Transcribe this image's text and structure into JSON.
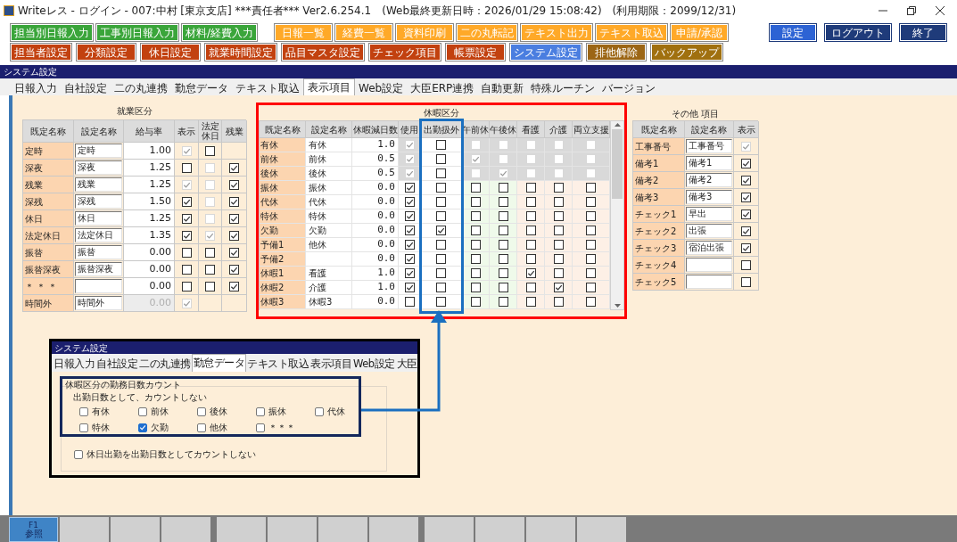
{
  "title_bar": {
    "app": "Writeレス - ログイン - 007:中村 [東京支店] ***責任者***  Ver2.6.254.1",
    "updated": "(Web最終更新日時：2026/01/29 15:08:42)",
    "expiry": "(利用期限：2099/12/31)"
  },
  "toolbar_rows": [
    [
      {
        "label": "担当別日報入力",
        "color": "#3aa53a"
      },
      {
        "label": "工事別日報入力",
        "color": "#3aa53a"
      },
      {
        "label": "材料/経費入力",
        "color": "#3aa53a"
      },
      {
        "label": "日報一覧",
        "color": "#ffa928"
      },
      {
        "label": "経費一覧",
        "color": "#ffa928"
      },
      {
        "label": "資料印刷",
        "color": "#ffa928"
      },
      {
        "label": "二の丸転記",
        "color": "#ffa928"
      },
      {
        "label": "テキスト出力",
        "color": "#ffa928"
      },
      {
        "label": "テキスト取込",
        "color": "#ffa928"
      },
      {
        "label": "申請/承認",
        "color": "#ffa928"
      }
    ],
    [
      {
        "label": "担当者設定",
        "color": "#c2410f"
      },
      {
        "label": "分類設定",
        "color": "#c2410f"
      },
      {
        "label": "休日設定",
        "color": "#c2410f"
      },
      {
        "label": "就業時間設定",
        "color": "#c2410f"
      },
      {
        "label": "品目マスタ設定",
        "color": "#c2410f"
      },
      {
        "label": "チェック項目",
        "color": "#c2410f"
      },
      {
        "label": "帳票設定",
        "color": "#c2410f"
      },
      {
        "label": "システム設定",
        "color": "#4a7ee0"
      },
      {
        "label": "排他解除",
        "color": "#9c6615"
      },
      {
        "label": "バックアップ",
        "color": "#a0700f"
      }
    ]
  ],
  "right_buttons": [
    {
      "label": "設定",
      "color": "#2d63d4"
    },
    {
      "label": "ログアウト",
      "color": "#1f3b7a"
    },
    {
      "label": "終了",
      "color": "#1f3b7a"
    }
  ],
  "panel_title": "システム設定",
  "tabs": [
    {
      "label": "日報入力",
      "selected": false
    },
    {
      "label": "自社設定",
      "selected": false
    },
    {
      "label": "二の丸連携",
      "selected": false
    },
    {
      "label": "勤怠データ",
      "selected": false
    },
    {
      "label": "テキスト取込",
      "selected": false
    },
    {
      "label": "表示項目",
      "selected": true
    },
    {
      "label": "Web設定",
      "selected": false
    },
    {
      "label": "大臣ERP連携",
      "selected": false
    },
    {
      "label": "自動更新",
      "selected": false
    },
    {
      "label": "特殊ルーチン",
      "selected": false
    },
    {
      "label": "バージョン",
      "selected": false
    }
  ],
  "work_table": {
    "title": "就業区分",
    "columns": [
      "既定名称",
      "設定名称",
      "給与率",
      "表示",
      "法定休日",
      "残業"
    ],
    "rows": [
      {
        "default_name": "定時",
        "setting_name": "定時",
        "rate": "1.00",
        "rate_disabled": false,
        "checks": [
          {
            "kind": "box",
            "checked": true,
            "disabled": true
          },
          {
            "kind": "box",
            "checked": false,
            "disabled": false
          },
          {
            "kind": "none"
          }
        ]
      },
      {
        "default_name": "深夜",
        "setting_name": "深夜",
        "rate": "1.25",
        "rate_disabled": false,
        "checks": [
          {
            "kind": "box",
            "checked": false,
            "disabled": false
          },
          {
            "kind": "box",
            "checked": false,
            "disabled": true
          },
          {
            "kind": "box",
            "checked": true,
            "disabled": false
          }
        ]
      },
      {
        "default_name": "残業",
        "setting_name": "残業",
        "rate": "1.25",
        "rate_disabled": false,
        "checks": [
          {
            "kind": "box",
            "checked": true,
            "disabled": true
          },
          {
            "kind": "box",
            "checked": false,
            "disabled": true
          },
          {
            "kind": "box",
            "checked": true,
            "disabled": false
          }
        ]
      },
      {
        "default_name": "深残",
        "setting_name": "深残",
        "rate": "1.50",
        "rate_disabled": false,
        "checks": [
          {
            "kind": "box",
            "checked": true,
            "disabled": false
          },
          {
            "kind": "box",
            "checked": false,
            "disabled": true
          },
          {
            "kind": "box",
            "checked": true,
            "disabled": false
          }
        ]
      },
      {
        "default_name": "休日",
        "setting_name": "休日",
        "rate": "1.25",
        "rate_disabled": false,
        "checks": [
          {
            "kind": "box",
            "checked": true,
            "disabled": false
          },
          {
            "kind": "box",
            "checked": false,
            "disabled": true
          },
          {
            "kind": "box",
            "checked": true,
            "disabled": false
          }
        ]
      },
      {
        "default_name": "法定休日",
        "setting_name": "法定休日",
        "rate": "1.35",
        "rate_disabled": false,
        "checks": [
          {
            "kind": "box",
            "checked": true,
            "disabled": false
          },
          {
            "kind": "box",
            "checked": true,
            "disabled": true
          },
          {
            "kind": "box",
            "checked": true,
            "disabled": false
          }
        ]
      },
      {
        "default_name": "振替",
        "setting_name": "振替",
        "rate": "0.00",
        "rate_disabled": false,
        "checks": [
          {
            "kind": "box",
            "checked": false,
            "disabled": false
          },
          {
            "kind": "box",
            "checked": false,
            "disabled": false
          },
          {
            "kind": "box",
            "checked": true,
            "disabled": false
          }
        ]
      },
      {
        "default_name": "振替深夜",
        "setting_name": "振替深夜",
        "rate": "0.00",
        "rate_disabled": false,
        "checks": [
          {
            "kind": "box",
            "checked": false,
            "disabled": false
          },
          {
            "kind": "box",
            "checked": false,
            "disabled": false
          },
          {
            "kind": "box",
            "checked": true,
            "disabled": false
          }
        ]
      },
      {
        "default_name": "＊ ＊ ＊",
        "rate": "0.00",
        "rate_disabled": false,
        "checks": [
          {
            "kind": "box",
            "checked": false,
            "disabled": false
          },
          {
            "kind": "box",
            "checked": false,
            "disabled": false
          },
          {
            "kind": "box",
            "checked": true,
            "disabled": false
          }
        ]
      },
      {
        "default_name": "時間外",
        "setting_name": "時間外",
        "rate": "0.00",
        "rate_disabled": true,
        "checks": [
          {
            "kind": "box",
            "checked": true,
            "disabled": true
          },
          {
            "kind": "none"
          },
          {
            "kind": "none"
          }
        ]
      }
    ]
  },
  "leave_table": {
    "title": "休暇区分",
    "columns": [
      {
        "label": "既定名称"
      },
      {
        "label": "設定名称"
      },
      {
        "label": "休暇減日数"
      },
      {
        "label": "使用"
      },
      {
        "label": "出勤扱外"
      },
      {
        "label": "午前休",
        "color": "#effaea"
      },
      {
        "label": "午後休",
        "color": "#effaea"
      },
      {
        "label": "看護",
        "color": "#fdf0e6"
      },
      {
        "label": "介護",
        "color": "#fdf0e6"
      },
      {
        "label": "両立支援",
        "color": "#fdf0e6"
      }
    ],
    "rows": [
      {
        "default_name": "有休",
        "setting_name": "有休",
        "days": "1.0",
        "locked": true,
        "checks": [
          {
            "checked": true,
            "disabled": true
          },
          {
            "checked": false,
            "disabled": false
          },
          {
            "checked": false,
            "disabled": true
          },
          {
            "checked": false,
            "disabled": true
          },
          {
            "checked": false,
            "disabled": true
          },
          {
            "checked": false,
            "disabled": true
          },
          {
            "checked": false,
            "disabled": true
          }
        ]
      },
      {
        "default_name": "前休",
        "setting_name": "前休",
        "days": "0.5",
        "locked": true,
        "checks": [
          {
            "checked": true,
            "disabled": true
          },
          {
            "checked": false,
            "disabled": false
          },
          {
            "checked": true,
            "disabled": true
          },
          {
            "checked": false,
            "disabled": true
          },
          {
            "checked": false,
            "disabled": true
          },
          {
            "checked": false,
            "disabled": true
          },
          {
            "checked": false,
            "disabled": true
          }
        ]
      },
      {
        "default_name": "後休",
        "setting_name": "後休",
        "days": "0.5",
        "locked": true,
        "checks": [
          {
            "checked": true,
            "disabled": true
          },
          {
            "checked": false,
            "disabled": false
          },
          {
            "checked": false,
            "disabled": true
          },
          {
            "checked": true,
            "disabled": true
          },
          {
            "checked": false,
            "disabled": true
          },
          {
            "checked": false,
            "disabled": true
          },
          {
            "checked": false,
            "disabled": true
          }
        ]
      },
      {
        "default_name": "振休",
        "setting_name": "振休",
        "days": "0.0",
        "locked": false,
        "checks": [
          {
            "checked": true,
            "disabled": false
          },
          {
            "checked": false,
            "disabled": false
          },
          {
            "checked": false,
            "disabled": false
          },
          {
            "checked": false,
            "disabled": false
          },
          {
            "checked": false,
            "disabled": false
          },
          {
            "checked": false,
            "disabled": false
          },
          {
            "checked": false,
            "disabled": false
          }
        ]
      },
      {
        "default_name": "代休",
        "setting_name": "代休",
        "days": "0.0",
        "locked": false,
        "checks": [
          {
            "checked": true,
            "disabled": false
          },
          {
            "checked": false,
            "disabled": false
          },
          {
            "checked": false,
            "disabled": false
          },
          {
            "checked": false,
            "disabled": false
          },
          {
            "checked": false,
            "disabled": false
          },
          {
            "checked": false,
            "disabled": false
          },
          {
            "checked": false,
            "disabled": false
          }
        ]
      },
      {
        "default_name": "特休",
        "setting_name": "特休",
        "days": "0.0",
        "locked": false,
        "checks": [
          {
            "checked": true,
            "disabled": false
          },
          {
            "checked": false,
            "disabled": false
          },
          {
            "checked": false,
            "disabled": false
          },
          {
            "checked": false,
            "disabled": false
          },
          {
            "checked": false,
            "disabled": false
          },
          {
            "checked": false,
            "disabled": false
          },
          {
            "checked": false,
            "disabled": false
          }
        ]
      },
      {
        "default_name": "欠勤",
        "setting_name": "欠勤",
        "days": "0.0",
        "locked": false,
        "checks": [
          {
            "checked": true,
            "disabled": false
          },
          {
            "checked": true,
            "disabled": false
          },
          {
            "checked": false,
            "disabled": false
          },
          {
            "checked": false,
            "disabled": false
          },
          {
            "checked": false,
            "disabled": false
          },
          {
            "checked": false,
            "disabled": false
          },
          {
            "checked": false,
            "disabled": false
          }
        ]
      },
      {
        "default_name": "予備1",
        "setting_name": "他休",
        "days": "0.0",
        "locked": false,
        "checks": [
          {
            "checked": true,
            "disabled": false
          },
          {
            "checked": false,
            "disabled": false
          },
          {
            "checked": false,
            "disabled": false
          },
          {
            "checked": false,
            "disabled": false
          },
          {
            "checked": false,
            "disabled": false
          },
          {
            "checked": false,
            "disabled": false
          },
          {
            "checked": false,
            "disabled": false
          }
        ]
      },
      {
        "default_name": "予備2",
        "days": "0.0",
        "locked": false,
        "checks": [
          {
            "checked": true,
            "disabled": false
          },
          {
            "checked": false,
            "disabled": false
          },
          {
            "checked": false,
            "disabled": false
          },
          {
            "checked": false,
            "disabled": false
          },
          {
            "checked": false,
            "disabled": false
          },
          {
            "checked": false,
            "disabled": false
          },
          {
            "checked": false,
            "disabled": false
          }
        ]
      },
      {
        "default_name": "休暇1",
        "setting_name": "看護",
        "days": "1.0",
        "locked": false,
        "checks": [
          {
            "checked": true,
            "disabled": false
          },
          {
            "checked": false,
            "disabled": false
          },
          {
            "checked": false,
            "disabled": false
          },
          {
            "checked": false,
            "disabled": false
          },
          {
            "checked": true,
            "disabled": false
          },
          {
            "checked": false,
            "disabled": false
          },
          {
            "checked": false,
            "disabled": false
          }
        ]
      },
      {
        "default_name": "休暇2",
        "setting_name": "介護",
        "days": "1.0",
        "locked": false,
        "checks": [
          {
            "checked": true,
            "disabled": false
          },
          {
            "checked": false,
            "disabled": false
          },
          {
            "checked": false,
            "disabled": false
          },
          {
            "checked": false,
            "disabled": false
          },
          {
            "checked": false,
            "disabled": false
          },
          {
            "checked": true,
            "disabled": false
          },
          {
            "checked": false,
            "disabled": false
          }
        ]
      },
      {
        "default_name": "休暇3",
        "setting_name": "休暇3",
        "days": "0.0",
        "locked": false,
        "checks": [
          {
            "checked": false,
            "disabled": false
          },
          {
            "checked": false,
            "disabled": false
          },
          {
            "checked": false,
            "disabled": false
          },
          {
            "checked": false,
            "disabled": false
          },
          {
            "checked": false,
            "disabled": false
          },
          {
            "checked": false,
            "disabled": false
          },
          {
            "checked": false,
            "disabled": false
          }
        ]
      }
    ]
  },
  "other_table": {
    "title": "その他 項目",
    "columns": [
      "既定名称",
      "設定名称",
      "表示"
    ],
    "rows": [
      {
        "default_name": "工事番号",
        "setting_name": "工事番号",
        "show": {
          "checked": true,
          "disabled": true
        }
      },
      {
        "default_name": "備考1",
        "setting_name": "備考1",
        "show": {
          "checked": true,
          "disabled": false
        }
      },
      {
        "default_name": "備考2",
        "setting_name": "備考2",
        "show": {
          "checked": true,
          "disabled": false
        }
      },
      {
        "default_name": "備考3",
        "setting_name": "備考3",
        "show": {
          "checked": true,
          "disabled": false
        }
      },
      {
        "default_name": "チェック1",
        "setting_name": "早出",
        "show": {
          "checked": true,
          "disabled": false
        }
      },
      {
        "default_name": "チェック2",
        "setting_name": "出張",
        "show": {
          "checked": true,
          "disabled": false
        }
      },
      {
        "default_name": "チェック3",
        "setting_name": "宿泊出張",
        "show": {
          "checked": true,
          "disabled": false
        }
      },
      {
        "default_name": "チェック4",
        "show": {
          "checked": false,
          "disabled": false
        }
      },
      {
        "default_name": "チェック5",
        "show": {
          "checked": false,
          "disabled": false
        }
      }
    ]
  },
  "inset": {
    "title": "システム設定",
    "tabs": [
      {
        "label": "日報入力",
        "selected": false
      },
      {
        "label": "自社設定",
        "selected": false
      },
      {
        "label": "二の丸連携",
        "selected": false
      },
      {
        "label": "勤怠データ",
        "selected": true
      },
      {
        "label": "テキスト取込",
        "selected": false
      },
      {
        "label": "表示項目",
        "selected": false
      },
      {
        "label": "Web設定",
        "selected": false
      },
      {
        "label": "大臣",
        "selected": false
      }
    ],
    "group_title": "休暇区分の勤務日数カウント",
    "group_label": "出勤日数として、カウントしない",
    "options": [
      {
        "label": "有休",
        "checked": false
      },
      {
        "label": "前休",
        "checked": false
      },
      {
        "label": "後休",
        "checked": false
      },
      {
        "label": "振休",
        "checked": false
      },
      {
        "label": "代休",
        "checked": false
      },
      {
        "label": "特休",
        "checked": false
      },
      {
        "label": "欠勤",
        "checked": true
      },
      {
        "label": "他休",
        "checked": false
      },
      {
        "label": "＊＊＊",
        "checked": false
      }
    ],
    "holiday_option": {
      "label": "休日出勤を出勤日数としてカウントしない",
      "checked": false
    }
  },
  "function_keys": [
    {
      "label": "F1",
      "caption": "参照",
      "selected": true
    },
    {
      "selected": false
    },
    {
      "selected": false
    },
    {
      "selected": false
    },
    {
      "selected": false
    },
    {
      "selected": false
    },
    {
      "selected": false
    },
    {
      "selected": false
    },
    {
      "selected": false
    },
    {
      "selected": false
    },
    {
      "selected": false
    },
    {
      "selected": false
    }
  ]
}
